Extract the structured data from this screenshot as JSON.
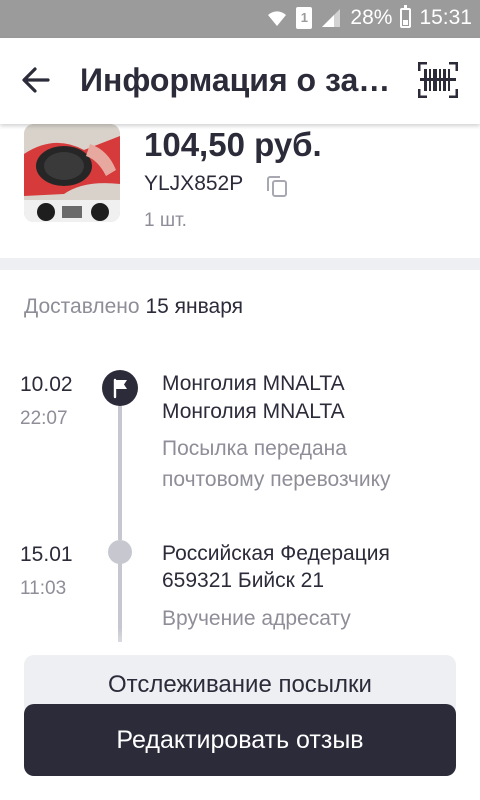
{
  "status_bar": {
    "sim_label": "1",
    "battery_text": "28%",
    "time": "15:31"
  },
  "app_bar": {
    "title": "Информация о заказе",
    "back_icon": "arrow-left-icon",
    "barcode_icon": "barcode-icon"
  },
  "order": {
    "price": "104,50 руб.",
    "tracking_code": "YLJX852P",
    "quantity": "1 шт."
  },
  "delivery": {
    "status_label": "Доставлено",
    "date": "15 января"
  },
  "timeline": [
    {
      "date": "10.02",
      "time": "22:07",
      "location_line1": "Монголия MNALTA",
      "location_line2": "Монголия MNALTA",
      "status_line1": "Посылка передана",
      "status_line2": "почтовому перевозчику",
      "icon": "flag-icon"
    },
    {
      "date": "15.01",
      "time": "11:03",
      "location_line1": "Российская Федерация",
      "location_line2": "659321 Бийск 21",
      "status_line1": "Вручение адресату",
      "status_line2": "",
      "icon": "dot-icon"
    }
  ],
  "actions": {
    "track_label": "Отслеживание посылки",
    "edit_review_label": "Редактировать отзыв"
  },
  "colors": {
    "primary_dark": "#2b2b3a",
    "muted_text": "#8e8e98",
    "light_bg": "#eeeff3",
    "status_bar": "#9b9b9b"
  }
}
